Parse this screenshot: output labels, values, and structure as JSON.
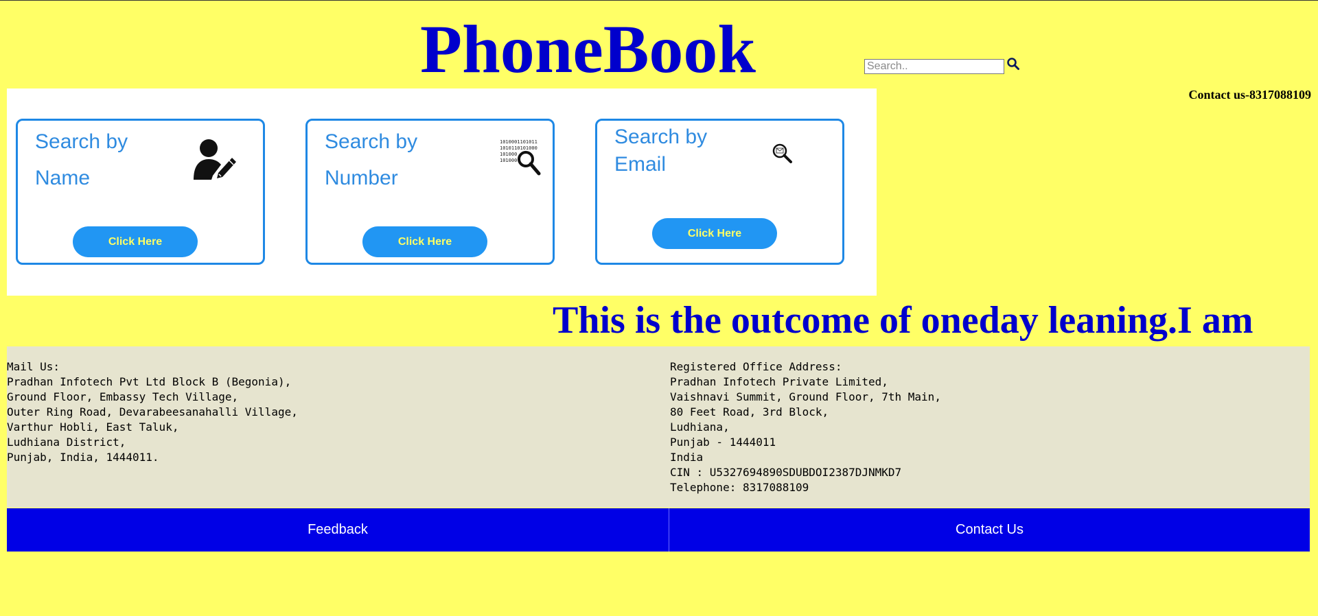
{
  "header": {
    "title": "PhoneBook",
    "search_placeholder": "Search..",
    "search_icon": "magnifier-icon",
    "contact": "Contact us-8317088109"
  },
  "cards": [
    {
      "title": "Search by Name",
      "icon": "person-edit-icon",
      "button": "Click Here"
    },
    {
      "title": "Search by Number",
      "icon": "binary-magnifier-icon",
      "button": "Click Here"
    },
    {
      "title": "Search by Email",
      "icon": "email-magnifier-icon",
      "button": "Click Here"
    }
  ],
  "marquee": "This is the outcome of oneday leaning.I am",
  "footer": {
    "mail_us": "Mail Us:\nPradhan Infotech Pvt Ltd Block B (Begonia),\nGround Floor, Embassy Tech Village,\nOuter Ring Road, Devarabeesanahalli Village,\nVarthur Hobli, East Taluk,\nLudhiana District,\nPunjab, India, 1444011.",
    "registered_office": "Registered Office Address:\nPradhan Infotech Private Limited,\nVaishnavi Summit, Ground Floor, 7th Main,\n80 Feet Road, 3rd Block,\nLudhiana,\nPunjab - 1444011\nIndia\nCIN : U5327694890SDUBDOI2387DJNMKD7\nTelephone: 8317088109",
    "nav": [
      "Feedback",
      "Contact Us"
    ]
  },
  "colors": {
    "background": "#ffff66",
    "title": "#0000cc",
    "card_border": "#1e88e5",
    "button": "#2196f3",
    "button_text": "#ffff66",
    "footer_bg": "#e6e4cf",
    "nav_bg": "#0000e6"
  }
}
